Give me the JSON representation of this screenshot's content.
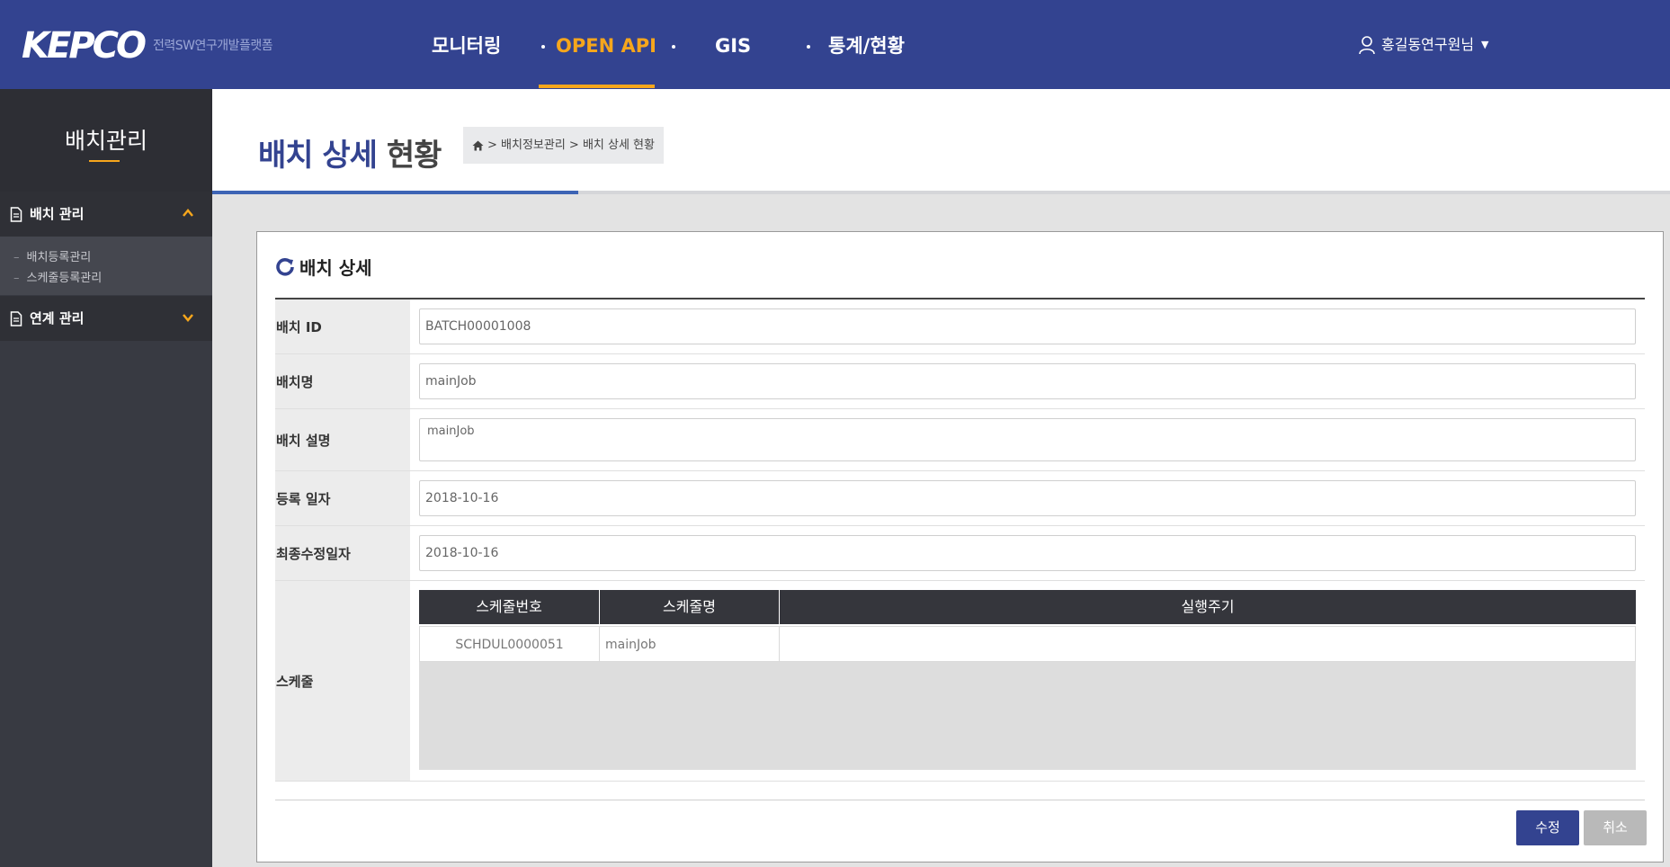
{
  "header": {
    "logo_text": "KEPCO",
    "logo_subtitle": "전력SW연구개발플랫폼",
    "nav": [
      {
        "label": "모니터링"
      },
      {
        "label": "OPEN API"
      },
      {
        "label": "GIS"
      },
      {
        "label": "통계/현황"
      }
    ],
    "user_label": "홍길동연구원님",
    "user_caret": "▼"
  },
  "sidebar": {
    "title": "배치관리",
    "groups": [
      {
        "label": "배치 관리",
        "expanded": true
      },
      {
        "label": "연계 관리",
        "expanded": false
      }
    ],
    "sub_items": [
      "배치등록관리",
      "스케줄등록관리"
    ]
  },
  "page": {
    "title_part1": "배치 상세",
    "title_part2": "현황",
    "breadcrumb": "> 배치정보관리 > 배치 상세 현황"
  },
  "panel": {
    "heading": "배치 상세",
    "fields": {
      "batch_id": {
        "label": "배치 ID",
        "value": "BATCH00001008"
      },
      "batch_name": {
        "label": "배치명",
        "value": "mainJob"
      },
      "batch_desc": {
        "label": "배치 설명",
        "value": "mainJob"
      },
      "reg_date": {
        "label": "등록 일자",
        "value": "2018-10-16"
      },
      "mod_date": {
        "label": "최종수정일자",
        "value": "2018-10-16"
      }
    },
    "schedule": {
      "label": "스케줄",
      "columns": [
        "스케줄번호",
        "스케줄명",
        "실행주기"
      ],
      "rows": [
        [
          "SCHDUL0000051",
          "mainJob",
          ""
        ]
      ]
    },
    "buttons": {
      "edit": "수정",
      "cancel": "취소"
    }
  },
  "colors": {
    "header_bg": "#334390",
    "accent": "#f6a61c",
    "sidebar_bg": "#383a42",
    "primary_button": "#334390"
  }
}
